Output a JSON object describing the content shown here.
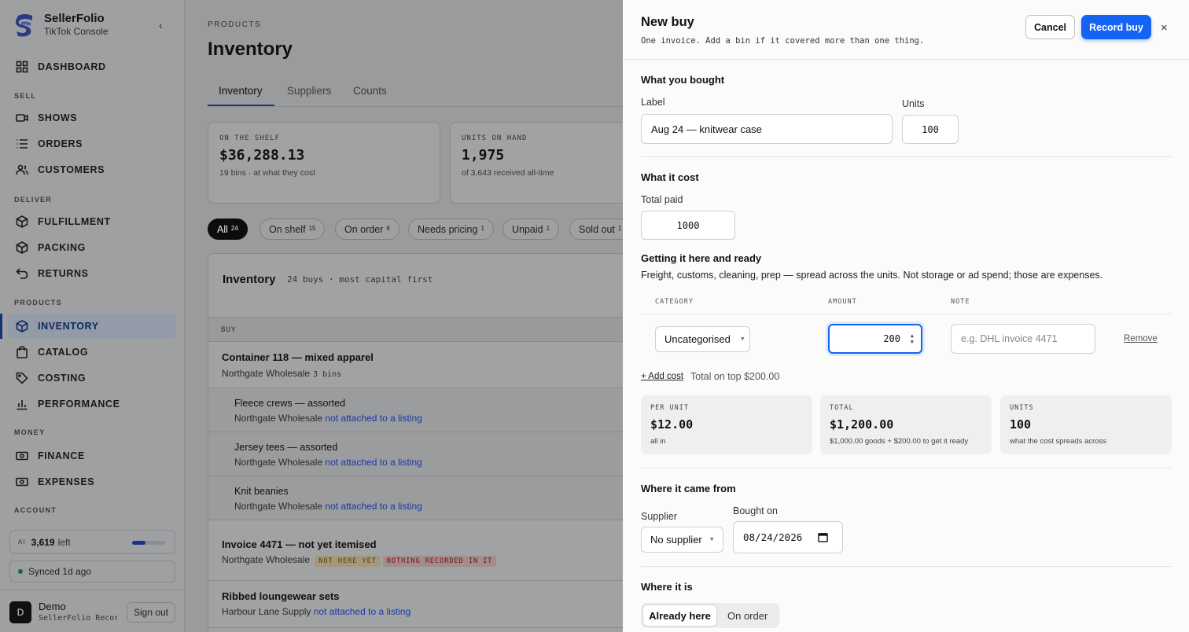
{
  "sidebar": {
    "brand_name": "SellerFolio",
    "brand_sub": "TikTok Console",
    "sections": [
      "SELL",
      "DELIVER",
      "PRODUCTS",
      "MONEY",
      "ACCOUNT"
    ],
    "items": [
      {
        "label": "DASHBOARD",
        "icon": "grid-icon"
      },
      {
        "label": "SHOWS",
        "icon": "video-icon"
      },
      {
        "label": "ORDERS",
        "icon": "list-icon"
      },
      {
        "label": "CUSTOMERS",
        "icon": "users-icon"
      },
      {
        "label": "FULFILLMENT",
        "icon": "box-icon"
      },
      {
        "label": "PACKING",
        "icon": "box-icon"
      },
      {
        "label": "RETURNS",
        "icon": "return-icon"
      },
      {
        "label": "INVENTORY",
        "icon": "box-icon",
        "active": true
      },
      {
        "label": "CATALOG",
        "icon": "bag-icon"
      },
      {
        "label": "COSTING",
        "icon": "tag-icon"
      },
      {
        "label": "PERFORMANCE",
        "icon": "bar-chart-icon"
      },
      {
        "label": "FINANCE",
        "icon": "banknote-icon"
      },
      {
        "label": "EXPENSES",
        "icon": "banknote-icon"
      }
    ],
    "ai_tag": "AI",
    "ai_value": "3,619",
    "ai_suffix": "left",
    "ai_usage_fraction": 0.4,
    "sync": "Synced 1d ago",
    "user_initial": "D",
    "user_name": "Demo",
    "user_sub": "SellerFolio Recor…",
    "signout": "Sign out"
  },
  "main": {
    "crumb": "PRODUCTS",
    "title": "Inventory",
    "tabs": [
      "Inventory",
      "Suppliers",
      "Counts"
    ],
    "stats": [
      {
        "label": "ON THE SHELF",
        "value": "$36,288.13",
        "sub": "19 bins · at what they cost"
      },
      {
        "label": "UNITS ON HAND",
        "value": "1,975",
        "sub": "of 3,643 received all-time"
      }
    ],
    "chips": [
      {
        "label": "All",
        "count": "24"
      },
      {
        "label": "On shelf",
        "count": "15"
      },
      {
        "label": "On order",
        "count": "6"
      },
      {
        "label": "Needs pricing",
        "count": "1"
      },
      {
        "label": "Unpaid",
        "count": "1"
      },
      {
        "label": "Sold out",
        "count": "1"
      }
    ],
    "list_title": "Inventory",
    "list_sub": "24 buys · most capital first",
    "col_buy": "BUY",
    "rows": [
      {
        "title": "Container 118 — mixed apparel",
        "supplier": "Northgate Wholesale",
        "bins": "3 bins"
      },
      {
        "title": "Fleece crews — assorted",
        "supplier": "Northgate Wholesale",
        "link": "not attached to a listing"
      },
      {
        "title": "Jersey tees — assorted",
        "supplier": "Northgate Wholesale",
        "link": "not attached to a listing"
      },
      {
        "title": "Knit beanies",
        "supplier": "Northgate Wholesale",
        "link": "not attached to a listing"
      },
      {
        "title": "Invoice 4471 — not yet itemised",
        "supplier": "Northgate Wholesale",
        "badge1": "NOT HERE YET",
        "badge2": "NOTHING RECORDED IN IT"
      },
      {
        "title": "Ribbed loungewear sets",
        "supplier": "Harbour Lane Supply",
        "link": "not attached to a listing"
      }
    ]
  },
  "drawer": {
    "title": "New buy",
    "subtitle": "One invoice. Add a bin if it covered more than one thing.",
    "cancel": "Cancel",
    "record": "Record buy",
    "close": "×",
    "bought_heading": "What you bought",
    "label_label": "Label",
    "label_value": "Aug 24 — knitwear case",
    "units_label": "Units",
    "units_value": "100",
    "cost_heading": "What it cost",
    "total_paid_label": "Total paid",
    "total_paid_value": "1000",
    "ready_heading": "Getting it here and ready",
    "ready_desc": "Freight, customs, cleaning, prep — spread across the units. Not storage or ad spend; those are expenses.",
    "col_category": "CATEGORY",
    "col_amount": "AMOUNT",
    "col_note": "NOTE",
    "category_value": "Uncategorised",
    "amount_value": "200",
    "note_placeholder": "e.g. DHL invoice 4471",
    "remove": "Remove",
    "add_cost": "+ Add cost",
    "total_on_top": "Total on top $200.00",
    "cards": [
      {
        "label": "PER UNIT",
        "value": "$12.00",
        "sub": "all in"
      },
      {
        "label": "TOTAL",
        "value": "$1,200.00",
        "sub": "$1,000.00 goods + $200.00 to get it ready"
      },
      {
        "label": "UNITS",
        "value": "100",
        "sub": "what the cost spreads across"
      }
    ],
    "from_heading": "Where it came from",
    "supplier_label": "Supplier",
    "supplier_value": "No supplier",
    "bought_on_label": "Bought on",
    "bought_on_value": "08/24/2026",
    "where_heading": "Where it is",
    "seg_on": "Already here",
    "seg_off": "On order"
  }
}
